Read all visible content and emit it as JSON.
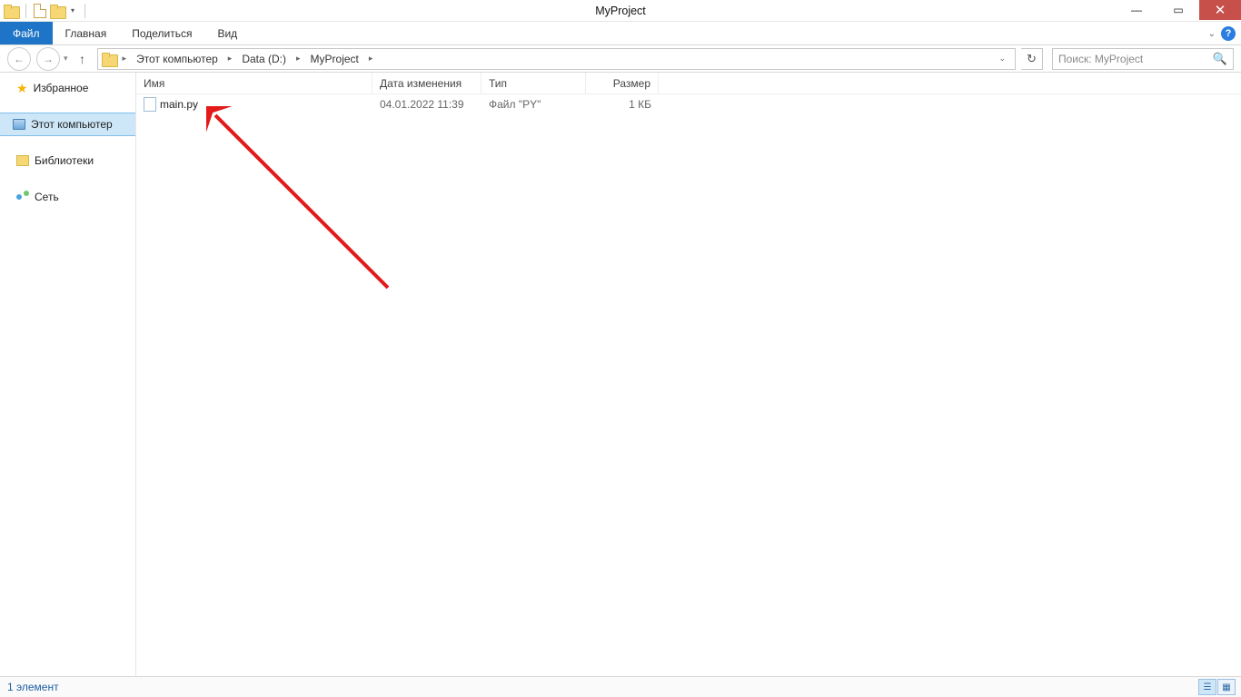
{
  "window": {
    "title": "MyProject"
  },
  "ribbon": {
    "file": "Файл",
    "tabs": [
      "Главная",
      "Поделиться",
      "Вид"
    ]
  },
  "breadcrumb": {
    "items": [
      "Этот компьютер",
      "Data (D:)",
      "MyProject"
    ]
  },
  "search": {
    "placeholder": "Поиск: MyProject"
  },
  "sidebar": {
    "favorites": "Избранное",
    "this_pc": "Этот компьютер",
    "libraries": "Библиотеки",
    "network": "Сеть"
  },
  "columns": {
    "name": "Имя",
    "date": "Дата изменения",
    "type": "Тип",
    "size": "Размер"
  },
  "files": [
    {
      "name": "main.py",
      "date": "04.01.2022 11:39",
      "type": "Файл \"PY\"",
      "size": "1 КБ"
    }
  ],
  "status": {
    "count": "1 элемент"
  }
}
